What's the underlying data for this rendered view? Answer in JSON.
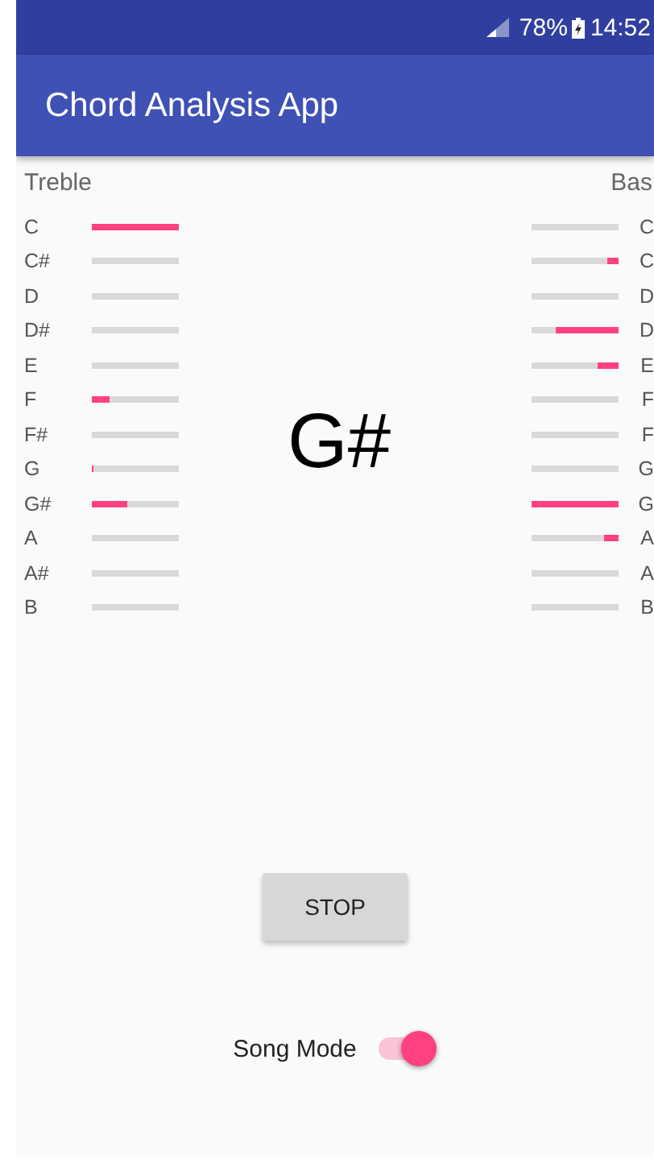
{
  "status_bar": {
    "battery": "78%",
    "time": "14:52"
  },
  "app_bar": {
    "title": "Chord Analysis App"
  },
  "treble": {
    "heading": "Treble",
    "notes": [
      {
        "label": "C",
        "level": 1.0
      },
      {
        "label": "C#"
      },
      {
        "label": "D"
      },
      {
        "label": "D#"
      },
      {
        "label": "E"
      },
      {
        "label": "F",
        "level": 0.2
      },
      {
        "label": "F#"
      },
      {
        "label": "G",
        "level": 0.02
      },
      {
        "label": "G#",
        "level": 0.4
      },
      {
        "label": "A"
      },
      {
        "label": "A#"
      },
      {
        "label": "B"
      }
    ]
  },
  "bass": {
    "heading": "Bas",
    "notes": [
      {
        "label": "C"
      },
      {
        "label": "C",
        "level": 0.13
      },
      {
        "label": "D"
      },
      {
        "label": "D",
        "level": 0.73
      },
      {
        "label": "E",
        "level": 0.25
      },
      {
        "label": "F"
      },
      {
        "label": "F"
      },
      {
        "label": "G"
      },
      {
        "label": "G",
        "level": 1.0
      },
      {
        "label": "A",
        "level": 0.17
      },
      {
        "label": "A"
      },
      {
        "label": "B"
      }
    ]
  },
  "chord": "G#",
  "stop_button": "STOP",
  "song_mode": {
    "label": "Song Mode",
    "on": true
  }
}
